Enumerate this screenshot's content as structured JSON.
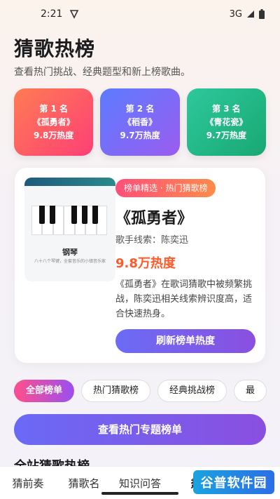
{
  "status": {
    "time": "2:21",
    "network": "3G"
  },
  "header": {
    "title": "猜歌热榜",
    "subtitle": "查看热门挑战、经典题型和新上榜歌曲。"
  },
  "rank_cards": [
    {
      "rank": "第 1 名",
      "song": "《孤勇者》",
      "heat": "9.8万热度"
    },
    {
      "rank": "第 2 名",
      "song": "《稻香》",
      "heat": "9.7万热度"
    },
    {
      "rank": "第 3 名",
      "song": "《青花瓷》",
      "heat": "9.7万热度"
    }
  ],
  "featured": {
    "cover_title": "钢琴",
    "cover_subtitle": "八十八个琴键，全套音乐的小镇音乐家",
    "tag": "榜单精选 · 热门猜歌榜",
    "title": "《孤勇者》",
    "singer": "歌手线索：陈奕迅",
    "heat": "9.8万热度",
    "description": "《孤勇者》在歌词猜歌中被频繁挑战，陈奕迅相关线索辨识度高，适合快速热身。",
    "refresh_label": "刷新榜单热度"
  },
  "filters": [
    "全部榜单",
    "热门猜歌榜",
    "经典挑战榜",
    "最"
  ],
  "topic_button": "查看热门专题榜单",
  "section_title": "全站猜歌热榜",
  "bottom_nav": [
    "猜前奏",
    "猜歌名",
    "知识问答",
    "热"
  ],
  "watermark": "谷普软件园",
  "colors": {
    "heat": "#ff5a2a",
    "accent": "#7b5cf0"
  }
}
